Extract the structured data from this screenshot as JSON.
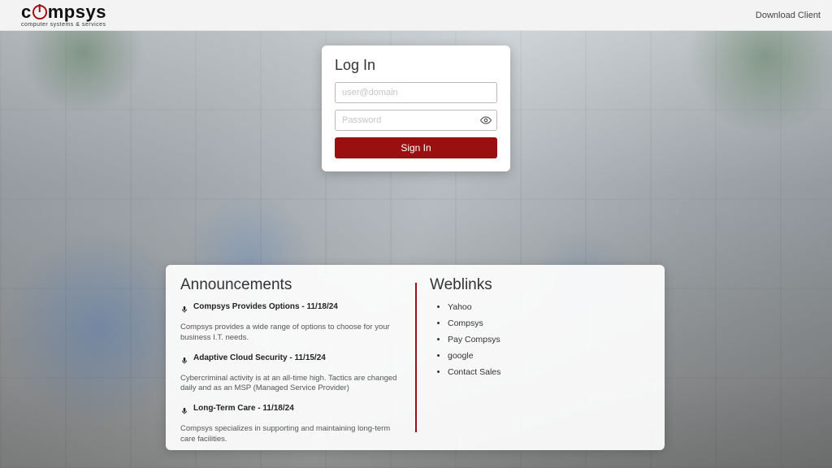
{
  "brand": {
    "pre": "c",
    "post": "mpsys",
    "tagline": "computer systems & services"
  },
  "topbar": {
    "download_client": "Download Client"
  },
  "login": {
    "title": "Log In",
    "user_placeholder": "user@domain",
    "password_placeholder": "Password",
    "signin_label": "Sign In"
  },
  "announcements": {
    "heading": "Announcements",
    "items": [
      {
        "title": "Compsys Provides Options - 11/18/24",
        "body": "Compsys provides a wide range of options to choose for your business I.T. needs."
      },
      {
        "title": "Adaptive Cloud Security - 11/15/24",
        "body": "Cybercriminal activity is at an all-time high. Tactics are changed daily and as an MSP (Managed Service Provider)"
      },
      {
        "title": "Long-Term Care - 11/18/24",
        "body": "Compsys specializes in supporting and maintaining long-term care facilities."
      }
    ]
  },
  "weblinks": {
    "heading": "Weblinks",
    "items": [
      "Yahoo",
      "Compsys",
      "Pay Compsys",
      "google",
      "Contact Sales"
    ]
  }
}
